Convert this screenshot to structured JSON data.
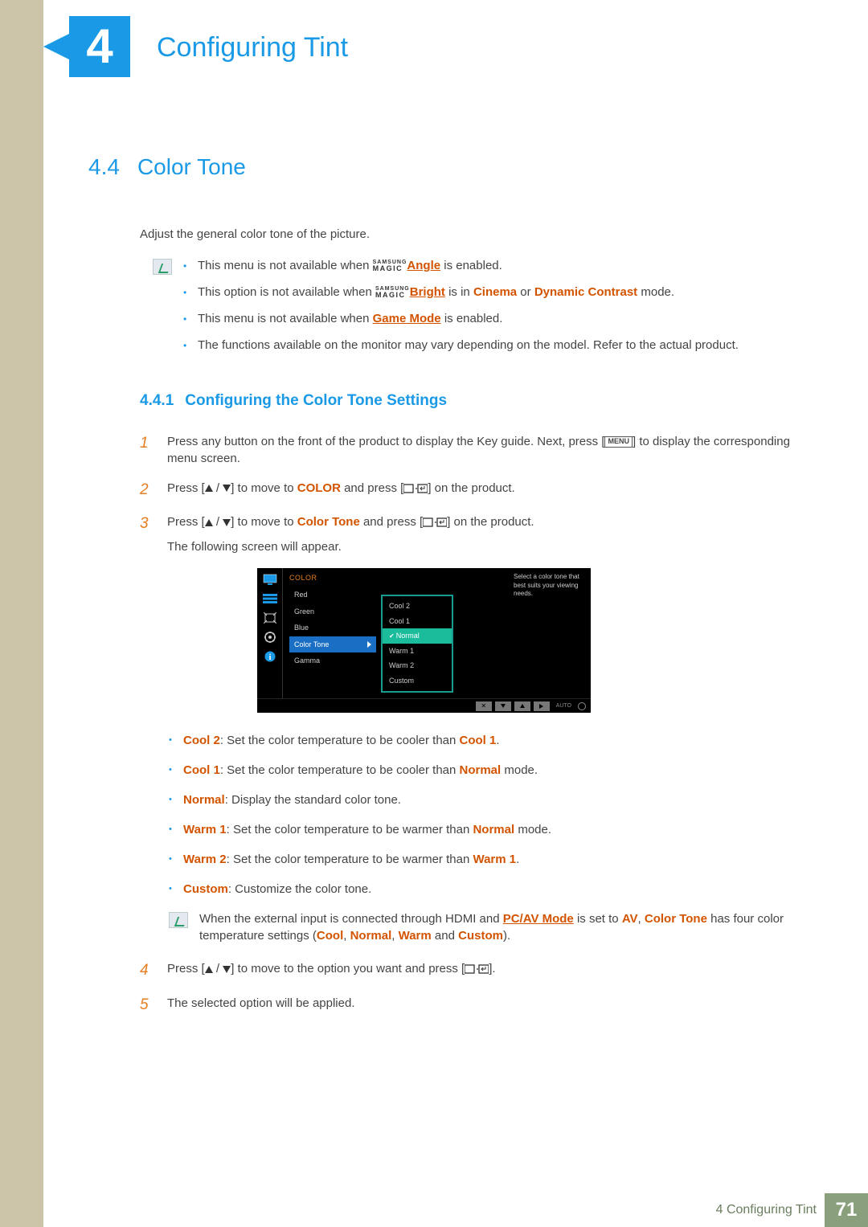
{
  "chapter": {
    "number": "4",
    "title": "Configuring Tint"
  },
  "section": {
    "number": "4.4",
    "title": "Color Tone"
  },
  "intro": "Adjust the general color tone of the picture.",
  "notes": {
    "n1a": "This menu is not available when ",
    "n1_link": "Angle",
    "n1b": " is enabled.",
    "n2a": "This option is not available when ",
    "n2_link": "Bright",
    "n2b": " is in ",
    "n2_c": "Cinema",
    "n2_d": " or ",
    "n2_e": "Dynamic Contrast",
    "n2_f": " mode.",
    "n3a": "This menu is not available when ",
    "n3_link": "Game Mode",
    "n3b": " is enabled.",
    "n4": "The functions available on the monitor may vary depending on the model. Refer to the actual product."
  },
  "magic": {
    "top": "SAMSUNG",
    "bot": "MAGIC"
  },
  "subsection": {
    "number": "4.4.1",
    "title": "Configuring the Color Tone Settings"
  },
  "steps": {
    "s1a": "Press any button on the front of the product to display the Key guide. Next, press [",
    "s1_menu": "MENU",
    "s1b": "] to display the corresponding menu screen.",
    "s2a": "Press [",
    "s2b": "] to move to ",
    "s2_color": "COLOR",
    "s2c": " and press [",
    "s2d": "] on the product.",
    "s3a": "Press [",
    "s3b": "] to move to ",
    "s3_ct": "Color Tone",
    "s3c": " and press [",
    "s3d": "] on the product.",
    "s3e": "The following screen will appear.",
    "s4a": "Press [",
    "s4b": "] to move to the option you want and press [",
    "s4c": "].",
    "s5": "The selected option will be applied."
  },
  "osd": {
    "header": "COLOR",
    "menu": [
      "Red",
      "Green",
      "Blue",
      "Color Tone",
      "Gamma"
    ],
    "options": [
      "Cool 2",
      "Cool 1",
      "Normal",
      "Warm 1",
      "Warm 2",
      "Custom"
    ],
    "help": "Select a color tone that best suits your viewing needs.",
    "auto": "AUTO"
  },
  "descriptions": {
    "cool2_h": "Cool 2",
    "cool2_t": ": Set the color temperature to be cooler than ",
    "cool2_r": "Cool 1",
    "cool2_e": ".",
    "cool1_h": "Cool 1",
    "cool1_t": ": Set the color temperature to be cooler than ",
    "cool1_r": "Normal",
    "cool1_e": " mode.",
    "normal_h": "Normal",
    "normal_t": ": Display the standard color tone.",
    "warm1_h": "Warm 1",
    "warm1_t": ": Set the color temperature to be warmer than ",
    "warm1_r": "Normal",
    "warm1_e": " mode.",
    "warm2_h": "Warm 2",
    "warm2_t": ": Set the color temperature to be warmer than ",
    "warm2_r": "Warm 1",
    "warm2_e": ".",
    "custom_h": "Custom",
    "custom_t": ": Customize the color tone."
  },
  "note2": {
    "a": "When the external input is connected through HDMI and ",
    "link": "PC/AV Mode",
    "b": " is set to ",
    "av": "AV",
    "c": ", ",
    "ct": "Color Tone",
    "d": " has four color temperature settings (",
    "cool": "Cool",
    "sep1": ", ",
    "normal": "Normal",
    "sep2": ", ",
    "warm": "Warm",
    "sep3": " and ",
    "custom": "Custom",
    "e": ")."
  },
  "footer": {
    "chapter_ref": "4",
    "title": "Configuring Tint",
    "page": "71"
  }
}
